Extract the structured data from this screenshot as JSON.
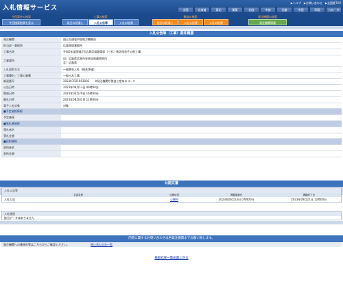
{
  "header": {
    "logo": "入札情報サービス",
    "links": [
      "▶ヘルプ",
      "▶お問い合わせ",
      "▶全国版TOP"
    ],
    "regions": [
      "全国",
      "北海道",
      "東北",
      "関東",
      "北陸",
      "中部",
      "近畿",
      "中国",
      "四国",
      "九州・沖"
    ]
  },
  "nav": {
    "groups": [
      {
        "head": "今回案件の検索",
        "tabs": [
          "今回検索結果を見る"
        ]
      },
      {
        "head": "工事の検索",
        "tabs": [
          "発注の見通し",
          "入札公告等",
          "入札の結果"
        ]
      },
      {
        "head": "業務の検索",
        "tabs": [
          "発注の見通し",
          "入札公告等",
          "入札の結果"
        ]
      },
      {
        "head": "発注機関の検索",
        "tabs": [
          "発注機関情報"
        ]
      }
    ]
  },
  "page_title": "入札公告等（工事）案件概要",
  "details": [
    {
      "label": "発注機関",
      "value": "国土交通省中国地方整備局",
      "type": "row"
    },
    {
      "label": "担当部・事務所",
      "value": "広島国道事務所",
      "type": "row"
    },
    {
      "label": "工事名称",
      "value": "令和5年度国道2号広島呉道路東部（三石）地区改良その他工事",
      "type": "row"
    },
    {
      "label": "工事場所",
      "value": "自）広島県広島市安芸区船越南地内\n至）広島県",
      "type": "tall"
    },
    {
      "label": "入札契約方式",
      "value": "一般競争入札（総合評価）",
      "type": "row"
    },
    {
      "label": "工事種別／工事の業種",
      "value": "一般土木工事",
      "type": "row"
    },
    {
      "label": "調達番号",
      "value": "202307021903002　　※発注機関が独自に定めるコード",
      "type": "row"
    },
    {
      "label": "公告日時",
      "value": "2023年06月13日 09時00分",
      "type": "row"
    },
    {
      "label": "期限日時",
      "value": "2023年06月29日 16時00分",
      "type": "row"
    },
    {
      "label": "開札日時",
      "value": "2023年08月02日 11時00分",
      "type": "row"
    },
    {
      "label": "電子入札対象",
      "value": "対象",
      "type": "row"
    },
    {
      "label": "■予定価格情報",
      "value": "",
      "type": "grp"
    },
    {
      "label": "予定価格",
      "value": "",
      "type": "row"
    },
    {
      "label": "■落札者情報",
      "value": "",
      "type": "grp"
    },
    {
      "label": "落札者名",
      "value": "",
      "type": "row"
    },
    {
      "label": "落札金額",
      "value": "",
      "type": "row"
    },
    {
      "label": "■契約情報",
      "value": "",
      "type": "grp"
    },
    {
      "label": "契約者名",
      "value": "",
      "type": "row"
    },
    {
      "label": "契約金額",
      "value": "",
      "type": "row"
    }
  ],
  "public_docs": {
    "title": "公開文書",
    "box_title": "入札公告等",
    "columns": [
      "文書名称",
      "公開状況",
      "掲載更新日",
      "掲載終了日"
    ],
    "rows": [
      {
        "name": "入札公告",
        "status": "公開中",
        "updated": "2023年06月13日 07時00分",
        "end": "2023年09月21日 12時00分"
      }
    ]
  },
  "bid_results": {
    "box_title": "入札経過",
    "message": "該当データはありません"
  },
  "inquiry": {
    "bar": "内容に関するお問い合わせは各発注機関までお願い致します。",
    "label": "発注機関への連絡先等はこちらからご確認ください。",
    "link": "問い合わせ先一覧"
  },
  "back_link": "検索結果一覧画面に戻る"
}
